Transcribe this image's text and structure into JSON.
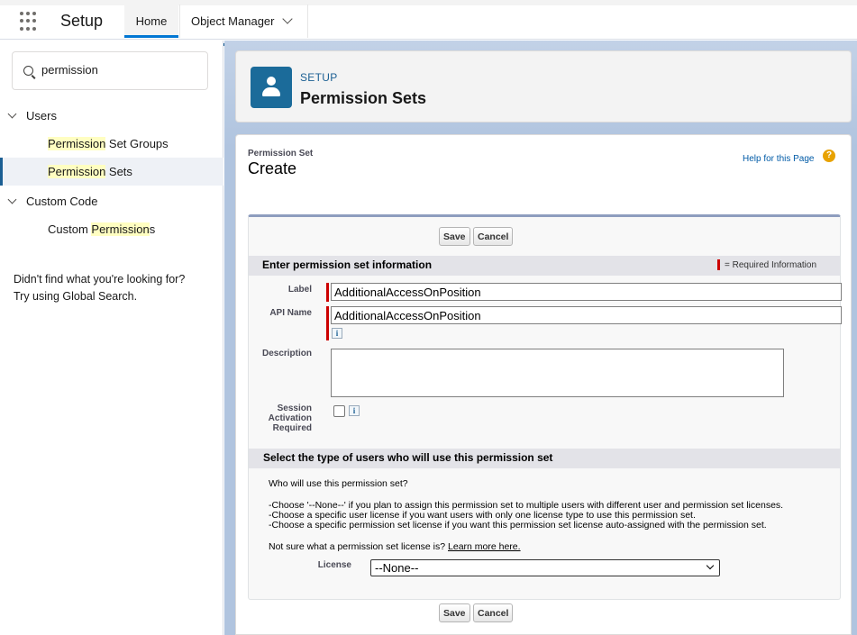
{
  "nav": {
    "app_name": "Setup",
    "tabs": [
      {
        "label": "Home"
      },
      {
        "label": "Object Manager"
      }
    ]
  },
  "sidebar": {
    "search_value": "permission",
    "tree": [
      {
        "label": "Users",
        "expanded": true
      },
      {
        "label_hl": "Permission",
        "label_rest": " Set Groups"
      },
      {
        "label_hl": "Permission",
        "label_rest": " Sets",
        "selected": true
      },
      {
        "label": "Custom Code",
        "expanded": true
      },
      {
        "label_pre": "Custom ",
        "label_hl": "Permission",
        "label_rest": "s"
      }
    ],
    "not_found_line1": "Didn't find what you're looking for?",
    "not_found_line2": "Try using Global Search."
  },
  "header": {
    "eyebrow": "SETUP",
    "title": "Permission Sets"
  },
  "form": {
    "page_sub": "Permission Set",
    "page_main": "Create",
    "help_link": "Help for this Page",
    "help_icon_glyph": "?",
    "save_label": "Save",
    "cancel_label": "Cancel",
    "section1_title": "Enter permission set information",
    "required_info": "= Required Information",
    "label_label": "Label",
    "label_value": "AdditionalAccessOnPosition",
    "api_name_label": "API Name",
    "api_name_value": "AdditionalAccessOnPosition",
    "description_label": "Description",
    "session_label_1": "Session",
    "session_label_2": "Activation",
    "session_label_3": "Required",
    "info_glyph": "i",
    "section2_title": "Select the type of users who will use this permission set",
    "who_text": "Who will use this permission set?",
    "choose_1": "-Choose '--None--' if you plan to assign this permission set to multiple users with different user and permission set licenses.",
    "choose_2": "-Choose a specific user license if you want users with only one license type to use this permission set.",
    "choose_3": "-Choose a specific permission set license if you want this permission set license auto-assigned with the permission set.",
    "not_sure": "Not sure what a permission set license is? ",
    "learn_more": "Learn more here.",
    "license_label": "License",
    "license_value": "--None--"
  }
}
